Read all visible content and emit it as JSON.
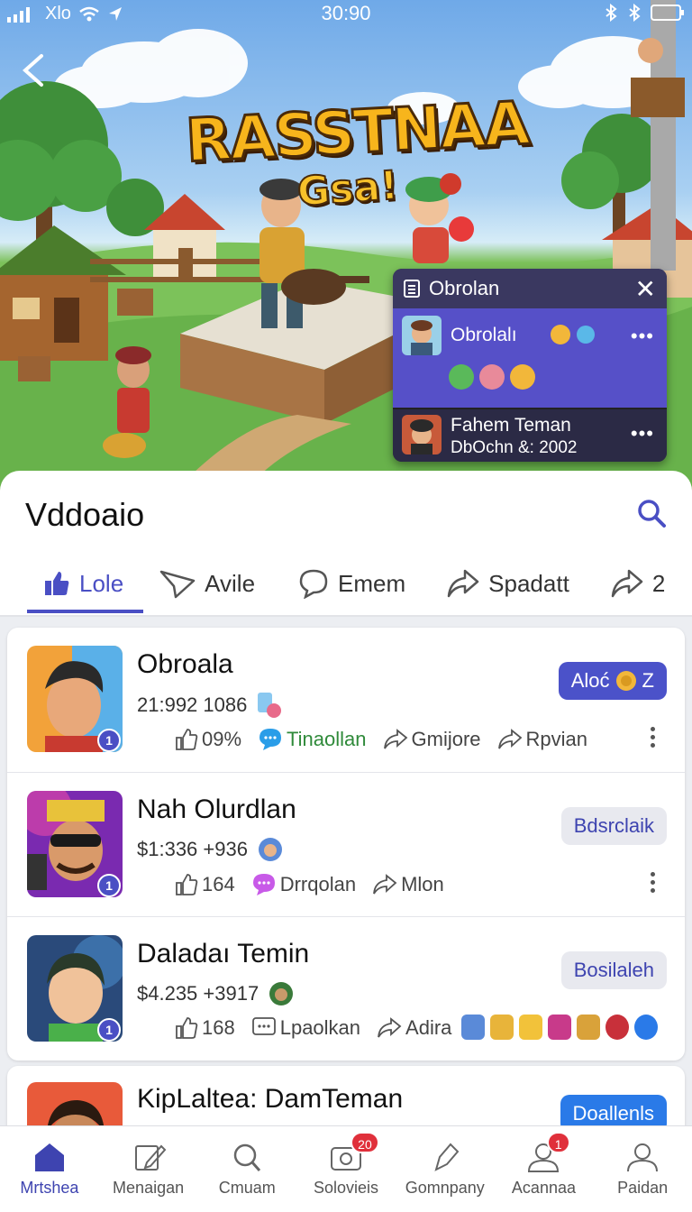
{
  "status_bar": {
    "carrier": "Xlo",
    "time": "30:90"
  },
  "hero": {
    "title": "RASSTNAA",
    "subtitle": "Gsa!"
  },
  "chat_popup": {
    "header": "Obrolan",
    "item1": {
      "name": "Obrolalı"
    },
    "item2": {
      "name": "Fahem Teman",
      "sub": "DbOchn &: 2002"
    }
  },
  "sheet": {
    "title": "Vddoaio",
    "tabs": [
      {
        "label": "Lole",
        "icon": "thumbs-up-icon"
      },
      {
        "label": "Avile",
        "icon": "send-icon"
      },
      {
        "label": "Emem",
        "icon": "chat-bubble-icon"
      },
      {
        "label": "Spadatt",
        "icon": "share-icon"
      },
      {
        "label": "2",
        "icon": "share-icon"
      }
    ]
  },
  "rows": [
    {
      "name": "Obroala",
      "meta": "21:992 1086",
      "badge": "1",
      "pill": "Aloć",
      "pill_suffix": "Z",
      "actions": [
        "09%",
        "Tinaollan",
        "Gmijore",
        "Rpvian"
      ]
    },
    {
      "name": "Nah Olurdlan",
      "meta": "$1:336 +936",
      "badge": "1",
      "pill": "Bdsrclaik",
      "actions": [
        "164",
        "Drrqolan",
        "Mlon"
      ]
    },
    {
      "name": "Daladaı Temin",
      "meta": "$4.235 +3917",
      "badge": "1",
      "pill": "Bosilaleh",
      "actions": [
        "168",
        "Lpaolkan",
        "Adira"
      ]
    },
    {
      "name": "KipLaltea: DamTeman",
      "meta": "",
      "pill": "Doallenls"
    }
  ],
  "bottom_nav": [
    {
      "label": "Mrtshea",
      "icon": "home-icon"
    },
    {
      "label": "Menaigan",
      "icon": "edit-icon"
    },
    {
      "label": "Cmuam",
      "icon": "search-icon"
    },
    {
      "label": "Solovieis",
      "icon": "camera-icon",
      "badge": "20"
    },
    {
      "label": "Gomnpany",
      "icon": "pen-icon"
    },
    {
      "label": "Acannaa",
      "icon": "user-icon",
      "badge": "1"
    },
    {
      "label": "Paidan",
      "icon": "profile-icon"
    }
  ],
  "colors": {
    "accent": "#4a4fc4",
    "badge_red": "#e0303b",
    "chat_bg": "#5650c8"
  }
}
